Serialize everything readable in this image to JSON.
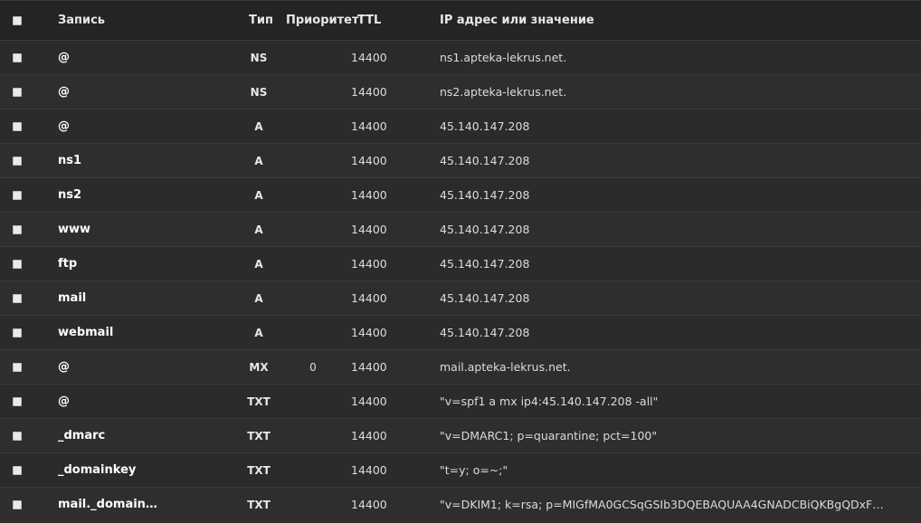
{
  "header": {
    "record": "Запись",
    "type": "Тип",
    "priority": "Приоритет",
    "ttl": "TTL",
    "value": "IP адрес или значение"
  },
  "rows": [
    {
      "name": "@",
      "type": "NS",
      "priority": "",
      "ttl": "14400",
      "value": "ns1.apteka-lekrus.net."
    },
    {
      "name": "@",
      "type": "NS",
      "priority": "",
      "ttl": "14400",
      "value": "ns2.apteka-lekrus.net."
    },
    {
      "name": "@",
      "type": "A",
      "priority": "",
      "ttl": "14400",
      "value": "45.140.147.208"
    },
    {
      "name": "ns1",
      "type": "A",
      "priority": "",
      "ttl": "14400",
      "value": "45.140.147.208"
    },
    {
      "name": "ns2",
      "type": "A",
      "priority": "",
      "ttl": "14400",
      "value": "45.140.147.208"
    },
    {
      "name": "www",
      "type": "A",
      "priority": "",
      "ttl": "14400",
      "value": "45.140.147.208"
    },
    {
      "name": "ftp",
      "type": "A",
      "priority": "",
      "ttl": "14400",
      "value": "45.140.147.208"
    },
    {
      "name": "mail",
      "type": "A",
      "priority": "",
      "ttl": "14400",
      "value": "45.140.147.208"
    },
    {
      "name": "webmail",
      "type": "A",
      "priority": "",
      "ttl": "14400",
      "value": "45.140.147.208"
    },
    {
      "name": "@",
      "type": "MX",
      "priority": "0",
      "ttl": "14400",
      "value": "mail.apteka-lekrus.net."
    },
    {
      "name": "@",
      "type": "TXT",
      "priority": "",
      "ttl": "14400",
      "value": "\"v=spf1 a mx ip4:45.140.147.208 -all\""
    },
    {
      "name": "_dmarc",
      "type": "TXT",
      "priority": "",
      "ttl": "14400",
      "value": "\"v=DMARC1; p=quarantine; pct=100\""
    },
    {
      "name": "_domainkey",
      "type": "TXT",
      "priority": "",
      "ttl": "14400",
      "value": "\"t=y; o=~;\""
    },
    {
      "name": "mail._domain…",
      "type": "TXT",
      "priority": "",
      "ttl": "14400",
      "value": "\"v=DKIM1; k=rsa; p=MIGfMA0GCSqGSIb3DQEBAQUAA4GNADCBiQKBgQDxF…"
    }
  ]
}
